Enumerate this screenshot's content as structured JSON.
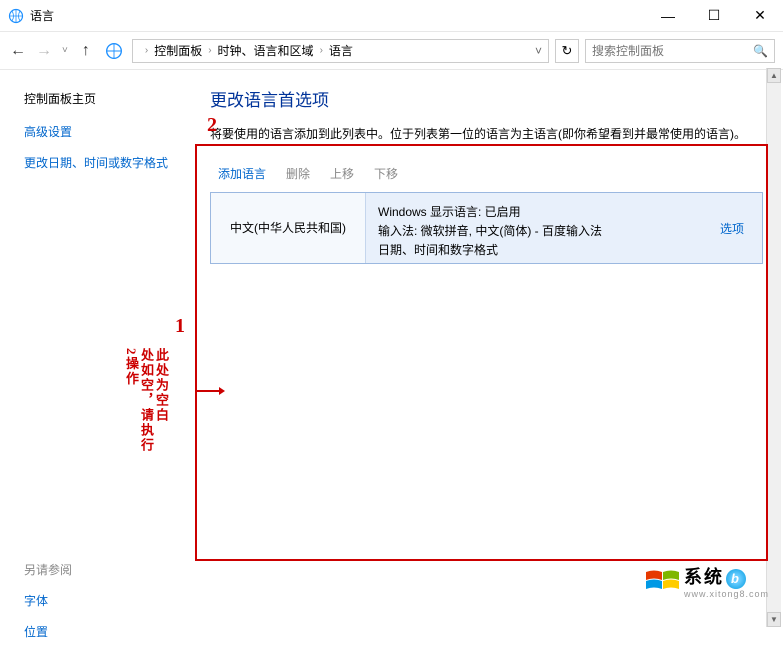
{
  "titlebar": {
    "title": "语言"
  },
  "nav": {
    "breadcrumb": [
      "控制面板",
      "时钟、语言和区域",
      "语言"
    ],
    "search_placeholder": "搜索控制面板"
  },
  "sidebar": {
    "home": "控制面板主页",
    "links": [
      "高级设置",
      "更改日期、时间或数字格式"
    ],
    "see_also": "另请参阅",
    "see_links": [
      "字体",
      "位置"
    ]
  },
  "main": {
    "heading": "更改语言首选项",
    "description": "将要使用的语言添加到此列表中。位于列表第一位的语言为主语言(即你希望看到并最常使用的语言)。",
    "toolbar": {
      "add": "添加语言",
      "remove": "删除",
      "up": "上移",
      "down": "下移"
    },
    "lang_row": {
      "name": "中文(中华人民共和国)",
      "line1": "Windows 显示语言: 已启用",
      "line2": "输入法: 微软拼音, 中文(简体) - 百度输入法",
      "line3": "日期、时间和数字格式",
      "option": "选项"
    }
  },
  "annotations": {
    "num1": "1",
    "num2": "2",
    "vtext_a": "此处为空白",
    "vtext_b": "处如空，请执行",
    "vtext_c": "2操作"
  },
  "watermark": {
    "line1": "系统",
    "line2": "www.xitong8.com",
    "badge": "b"
  }
}
